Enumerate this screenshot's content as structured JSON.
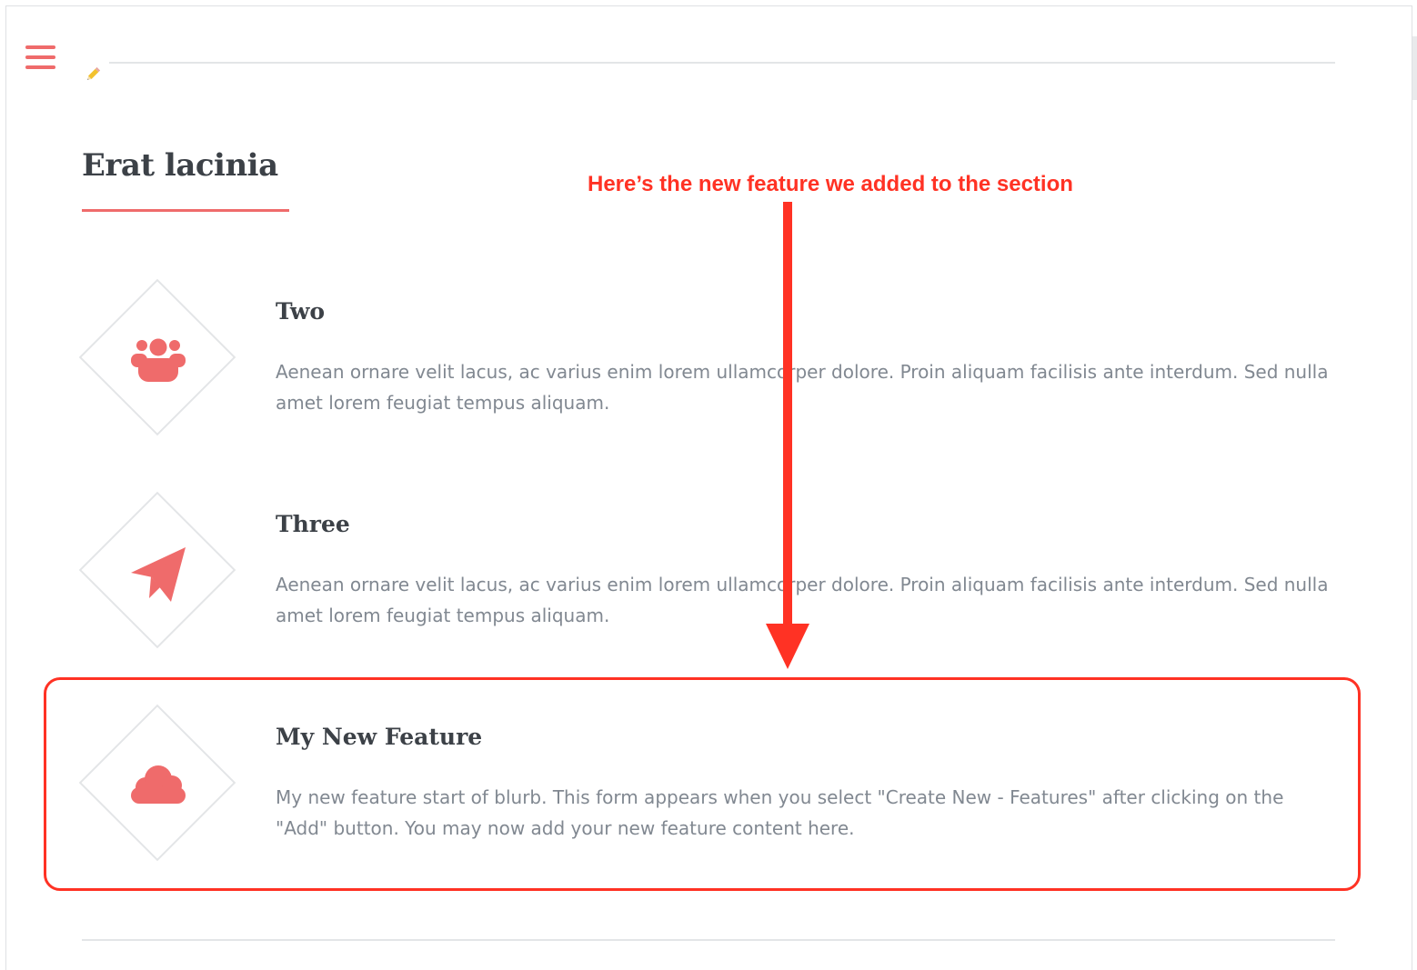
{
  "section": {
    "title": "Erat lacinia"
  },
  "features": [
    {
      "title": "Two",
      "text": "Aenean ornare velit lacus, ac varius enim lorem ullamcorper dolore. Proin aliquam facilisis ante interdum. Sed nulla amet lorem feugiat tempus aliquam.",
      "icon": "users-icon"
    },
    {
      "title": "Three",
      "text": "Aenean ornare velit lacus, ac varius enim lorem ullamcorper dolore. Proin aliquam facilisis ante interdum. Sed nulla amet lorem feugiat tempus aliquam.",
      "icon": "paper-plane-icon"
    },
    {
      "title": "My New Feature",
      "text": "My new feature start of blurb.  This form appears when you select \"Create New - Features\" after clicking on the \"Add\" button.  You may now add your new feature content here.",
      "icon": "cloud-icon"
    }
  ],
  "annotation": {
    "text": "Here’s the new feature we added to the section"
  },
  "colors": {
    "accent": "#ef6b6b",
    "annotation": "#ff3224",
    "heading": "#3c4147",
    "body_text": "#818891",
    "divider": "#e3e5e7"
  },
  "icons": {
    "menu": "hamburger-menu-icon",
    "edit": "pencil-icon"
  }
}
